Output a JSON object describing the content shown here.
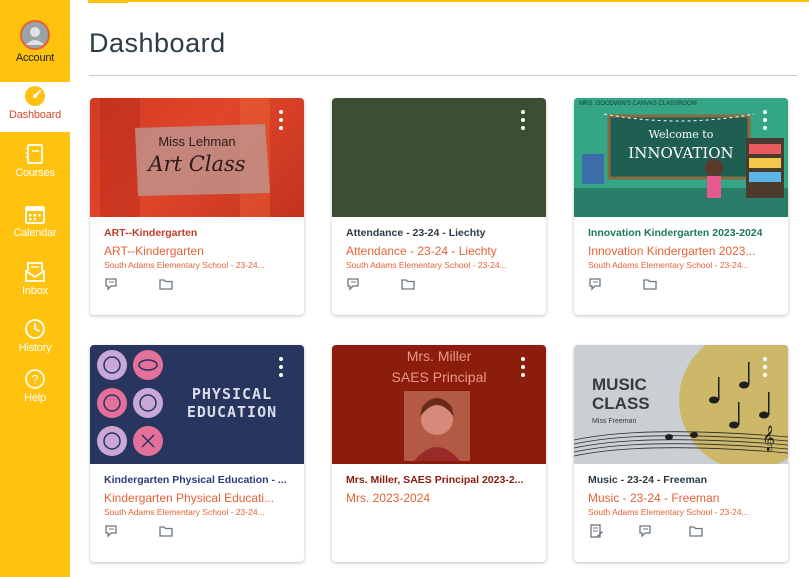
{
  "nav": {
    "items": [
      {
        "key": "account",
        "label": "Account",
        "icon": "avatar-icon"
      },
      {
        "key": "dashboard",
        "label": "Dashboard",
        "icon": "dashboard-icon"
      },
      {
        "key": "courses",
        "label": "Courses",
        "icon": "courses-icon"
      },
      {
        "key": "calendar",
        "label": "Calendar",
        "icon": "calendar-icon"
      },
      {
        "key": "inbox",
        "label": "Inbox",
        "icon": "inbox-icon"
      },
      {
        "key": "history",
        "label": "History",
        "icon": "history-icon"
      },
      {
        "key": "help",
        "label": "Help",
        "icon": "help-icon"
      }
    ]
  },
  "page": {
    "title": "Dashboard"
  },
  "colors": {
    "nav_bg": "#ffc20e",
    "accent": "#e66135",
    "active": "#d64a2b"
  },
  "cards": [
    {
      "title": "ART--Kindergarten",
      "title_color": "#c23c2a",
      "code": "ART--Kindergarten",
      "term": "South Adams Elementary School - 23-24...",
      "hero_line1": "Miss Lehman",
      "hero_line2": "Art Class",
      "actions": [
        "announcements-icon",
        "files-icon"
      ]
    },
    {
      "title": "Attendance - 23-24 - Liechty",
      "title_color": "#2d3b45",
      "code": "Attendance - 23-24 - Liechty",
      "term": "South Adams Elementary School - 23-24...",
      "actions": [
        "announcements-icon",
        "files-icon"
      ]
    },
    {
      "title": "Innovation Kindergarten 2023-2024",
      "title_color": "#1b7a57",
      "code": "Innovation Kindergarten 2023...",
      "term": "South Adams Elementary School - 23-24...",
      "hero_top": "MRS. GOODWIN'S CANVAS CLASSROOM",
      "hero_line1": "Welcome to",
      "hero_line2": "INNOVATION",
      "actions": [
        "announcements-icon",
        "files-icon"
      ]
    },
    {
      "title": "Kindergarten Physical Education - ...",
      "title_color": "#2b3a7a",
      "code": "Kindergarten Physical Educati...",
      "term": "South Adams Elementary School - 23-24...",
      "hero_line1": "PHYSICAL",
      "hero_line2": "EDUCATION",
      "actions": [
        "announcements-icon",
        "files-icon"
      ]
    },
    {
      "title": "Mrs. Miller, SAES Principal 2023-2...",
      "title_color": "#8a1b0f",
      "code": "Mrs. 2023-2024",
      "term": "",
      "hero_line1": "Mrs. Miller",
      "hero_line2": "SAES Principal",
      "actions": []
    },
    {
      "title": "Music - 23-24 - Freeman",
      "title_color": "#2d3b45",
      "code": "Music - 23-24 - Freeman",
      "term": "South Adams Elementary School - 23-24...",
      "hero_line1": "MUSIC",
      "hero_line2": "CLASS",
      "hero_line3": "Miss Freeman",
      "actions": [
        "assignments-icon",
        "announcements-icon",
        "files-icon"
      ]
    }
  ]
}
